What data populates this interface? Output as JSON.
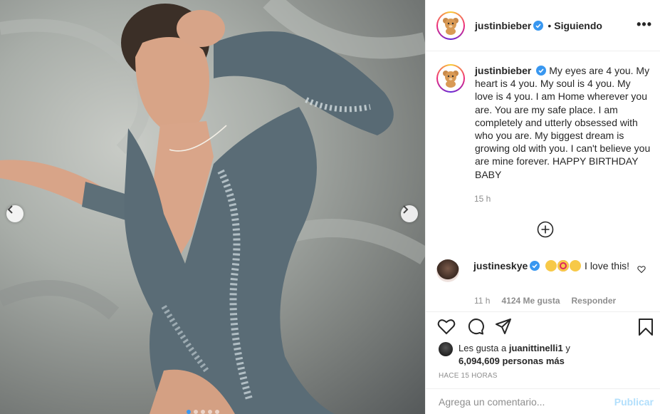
{
  "post": {
    "username": "justinbieber",
    "follow_status": "Siguiendo",
    "separator": "•",
    "more_label": "•••",
    "caption": "My eyes are 4 you. My heart is 4 you. My soul is 4 you. My love is 4 you. I am Home wherever you are. You are my safe place. I am completely and utterly obsessed with who you are. My biggest dream is growing old with you. I can't believe you are mine forever. HAPPY BIRTHDAY BABY",
    "caption_time": "15 h"
  },
  "comment": {
    "username": "justineskye",
    "emojis": [
      "crying-face",
      "heart-eyes-face",
      "star-struck-face"
    ],
    "text": "I love this!",
    "time": "11 h",
    "likes": "4124 Me gusta",
    "reply_label": "Responder"
  },
  "likes": {
    "prefix": "Les gusta a",
    "user": "juanittinelli1",
    "connector": "y",
    "count": "6,094,609 personas más"
  },
  "posted_ago": "Hace 15 horas",
  "add_comment": {
    "placeholder": "Agrega un comentario...",
    "publish_label": "Publicar"
  },
  "carousel": {
    "total_dots": 5,
    "active_dot": 1
  },
  "colors": {
    "verified": "#3897f0",
    "publish": "#b2dffc",
    "muted": "#8e8e8e"
  }
}
